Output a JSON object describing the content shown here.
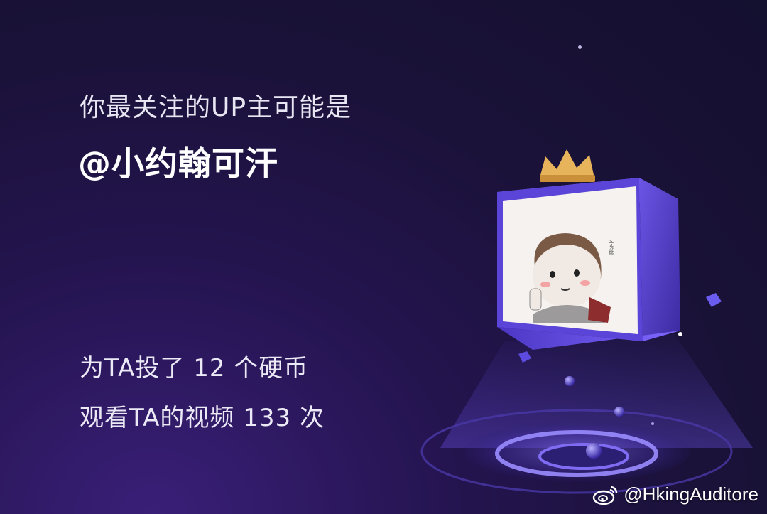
{
  "headline": "你最关注的UP主可能是",
  "username": "@小约翰可汗",
  "stats": {
    "coins": "为TA投了 12 个硬币",
    "views": "观看TA的视频 133 次"
  },
  "watermark": {
    "icon": "weibo-icon",
    "handle": "@HkingAuditore"
  },
  "colors": {
    "background": "#1a1238",
    "accent": "#6f4ee8",
    "crown": "#e7b45b"
  }
}
